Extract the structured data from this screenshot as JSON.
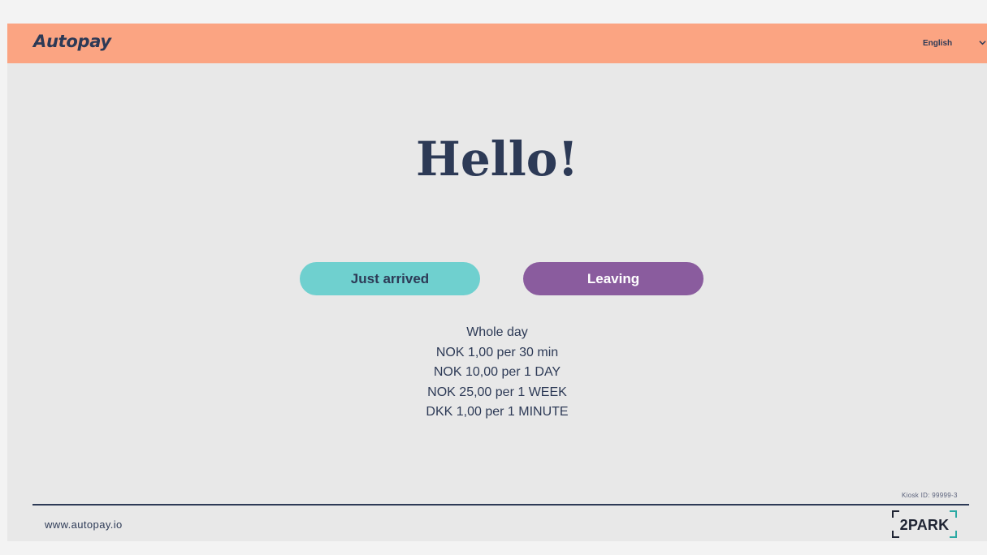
{
  "header": {
    "logo_text": "Autopay",
    "language": {
      "selected": "English",
      "icon": "chevron-down-icon"
    }
  },
  "main": {
    "greeting": "Hello!",
    "buttons": {
      "arrived_label": "Just arrived",
      "leaving_label": "Leaving"
    },
    "prices": [
      "Whole day",
      "NOK 1,00 per 30 min",
      "NOK 10,00 per 1 DAY",
      "NOK 25,00 per 1 WEEK",
      "DKK 1,00 per 1 MINUTE"
    ]
  },
  "footer": {
    "kiosk_id": "Kiosk ID: 99999-3",
    "website": "www.autopay.io",
    "partner_logo": "2PARK"
  },
  "colors": {
    "header_bg": "#fba482",
    "page_bg": "#e8e8e8",
    "primary_text": "#2d3a56",
    "arrive_button": "#6fd0cf",
    "leave_button": "#8a5c9e"
  }
}
